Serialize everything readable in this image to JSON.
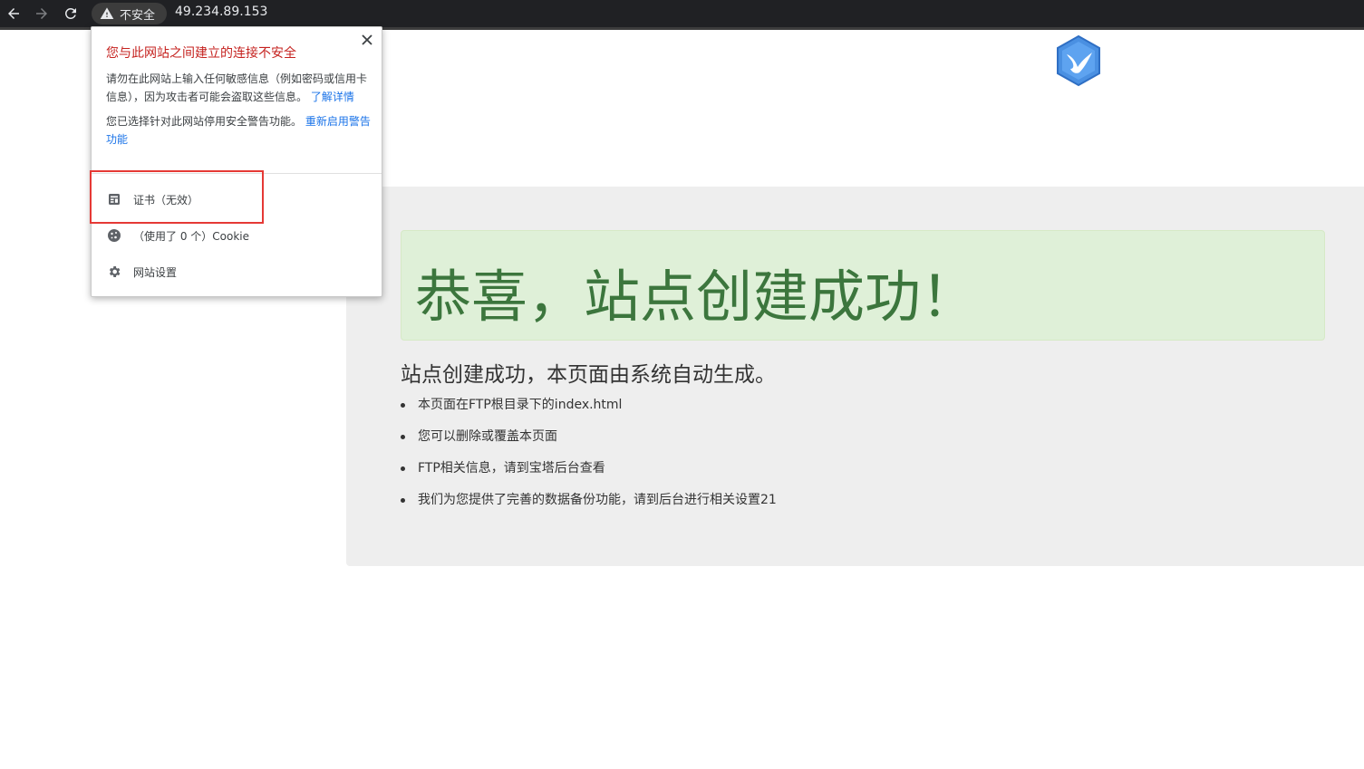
{
  "browser": {
    "security_chip": "不安全",
    "url": "49.234.89.153"
  },
  "page": {
    "jumbotron_title": "恭喜，站点创建成功！",
    "subtitle": "站点创建成功，本页面由系统自动生成。",
    "items": [
      "本页面在FTP根目录下的index.html",
      "您可以删除或覆盖本页面",
      "FTP相关信息，请到宝塔后台查看",
      "我们为您提供了完善的数据备份功能，请到后台进行相关设置21"
    ]
  },
  "popup": {
    "heading": "您与此网站之间建立的连接不安全",
    "body": "请勿在此网站上输入任何敏感信息（例如密码或信用卡信息），因为攻击者可能会盗取这些信息。",
    "learn_more": "了解详情",
    "body2": "您已选择针对此网站停用安全警告功能。",
    "re_enable": "重新启用警告功能",
    "certificate": "证书（无效）",
    "cookies": "（使用了 0 个）Cookie",
    "site_settings": "网站设置"
  },
  "colors": {
    "toolbar_bg": "#202124",
    "warning_red": "#c5221f",
    "link_blue": "#1a73e8",
    "success_green": "#3c763d",
    "highlight": "#e53935"
  }
}
